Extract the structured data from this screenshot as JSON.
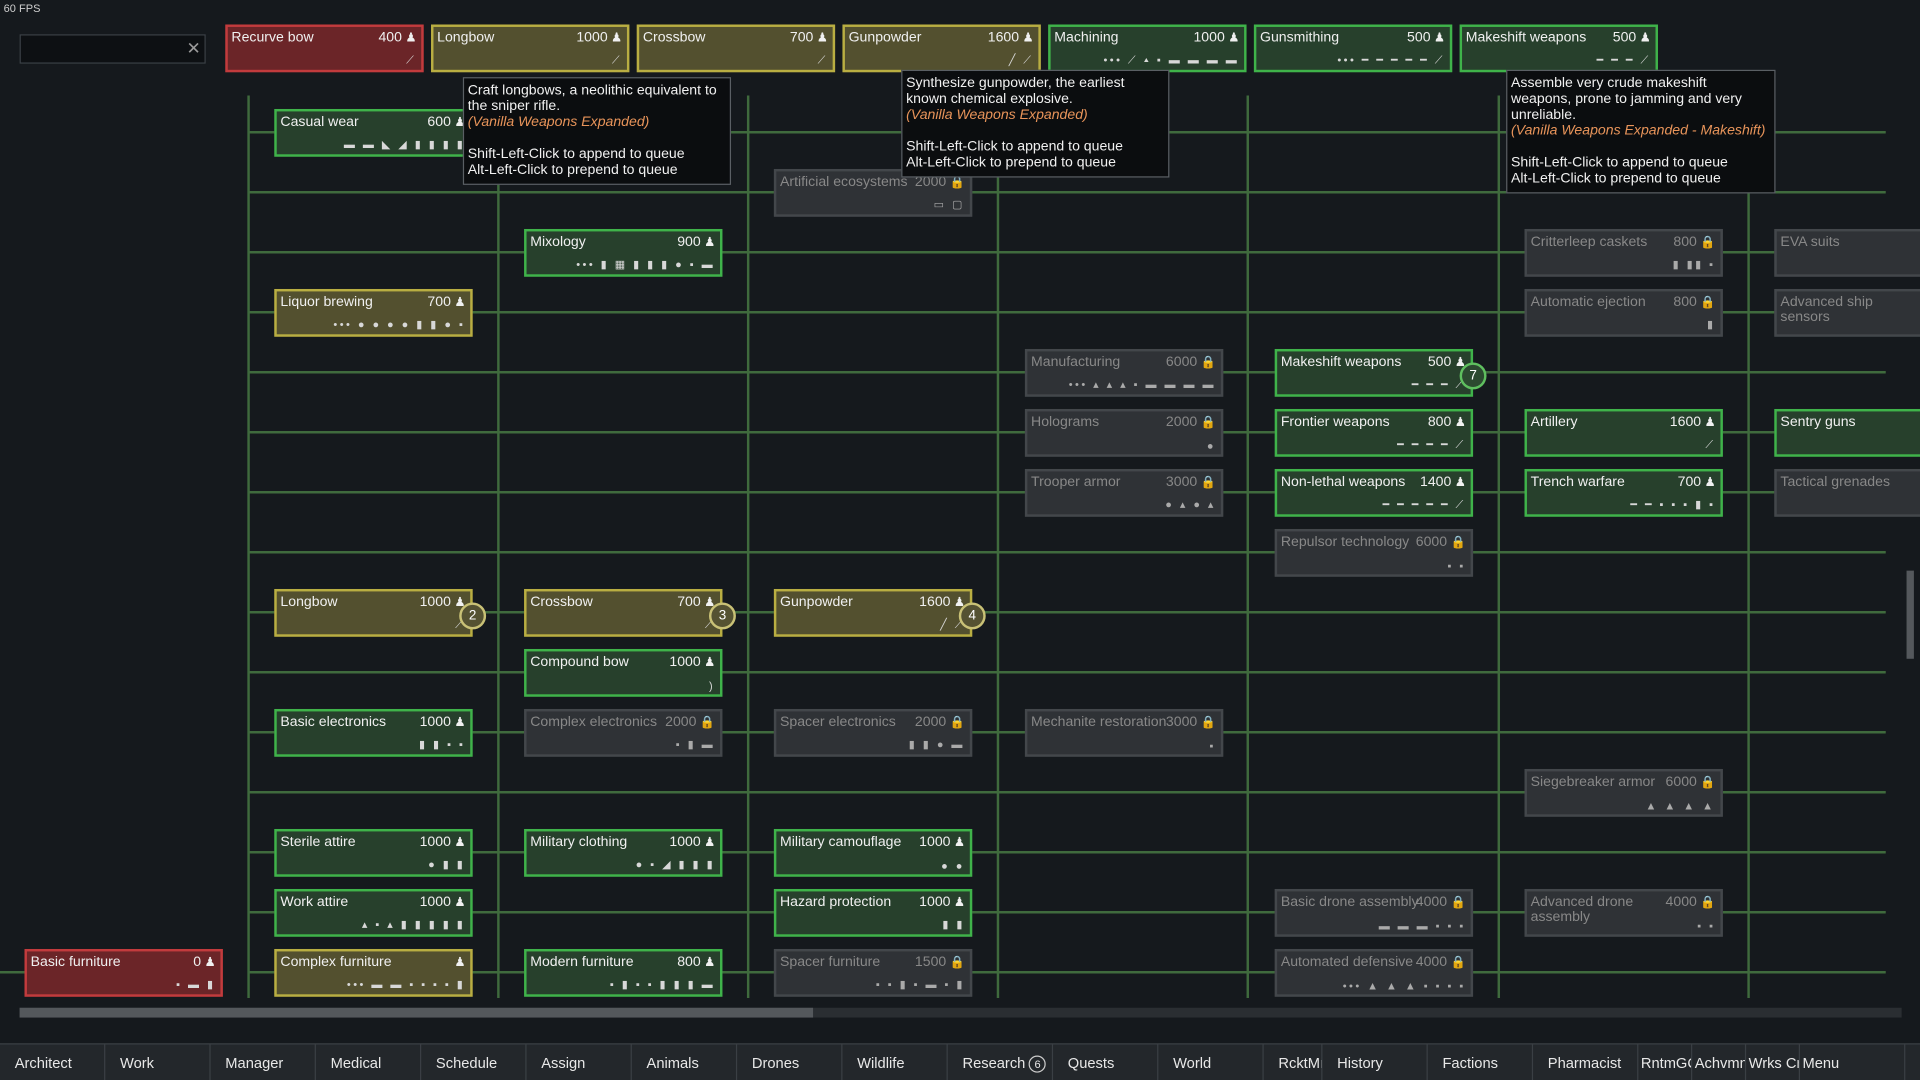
{
  "fps": "60 FPS",
  "search": {
    "value": "",
    "placeholder": ""
  },
  "colors": {
    "done": "#3fb34a",
    "queued": "#b9ae42",
    "selected": "#c23b3d",
    "locked": "#43474b",
    "wire": "#3f6a3d"
  },
  "queue": [
    {
      "name": "Recurve bow",
      "cost": "400",
      "state": "sel",
      "icons": "⟋"
    },
    {
      "name": "Longbow",
      "cost": "1000",
      "state": "queued",
      "icons": "⟋"
    },
    {
      "name": "Crossbow",
      "cost": "700",
      "state": "queued",
      "icons": "⟋"
    },
    {
      "name": "Gunpowder",
      "cost": "1600",
      "state": "queued",
      "icons": "╱ ⟋"
    },
    {
      "name": "Machining",
      "cost": "1000",
      "state": "done",
      "icons": "••• ⟋ ▴ ▪ ▬ ▬ ▬ ▬"
    },
    {
      "name": "Gunsmithing",
      "cost": "500",
      "state": "done",
      "icons": "••• ━ ━ ━ ━ ━ ⟋"
    },
    {
      "name": "Makeshift weapons",
      "cost": "500",
      "state": "done",
      "icons": "━ ━ ━ ⟋"
    }
  ],
  "nodes": [
    {
      "name": "Casual wear",
      "cost": "600",
      "state": "done",
      "icons": "▬ ▬ ◣ ◢ ▮ ▮ ▮ ▮"
    },
    {
      "name": "Artificial ecosystems",
      "cost": "2000",
      "state": "locked",
      "icons": "▭ ▢"
    },
    {
      "name": "Mixology",
      "cost": "900",
      "state": "done",
      "icons": "••• ▮ ▦ ▮ ▮ ▮ ● ▪ ▬"
    },
    {
      "name": "Liquor brewing",
      "cost": "700",
      "state": "queued",
      "icons": "••• ● ● ● ● ▮ ▮ ● ▪"
    },
    {
      "name": "Critterleep caskets",
      "cost": "800",
      "state": "locked",
      "icons": "▮ ▮▮ ▪"
    },
    {
      "name": "EVA suits",
      "cost": "",
      "state": "locked",
      "icons": ""
    },
    {
      "name": "Automatic ejection",
      "cost": "800",
      "state": "locked",
      "icons": "▮"
    },
    {
      "name": "Advanced ship sensors",
      "cost": "",
      "state": "locked",
      "icons": ""
    },
    {
      "name": "Manufacturing",
      "cost": "6000",
      "state": "locked",
      "icons": "••• ▴ ▴ ▴ ▪ ▬ ▬ ▬ ▬"
    },
    {
      "name": "Makeshift weapons",
      "cost": "500",
      "state": "done",
      "icons": "━ ━ ━ ⟋"
    },
    {
      "name": "Holograms",
      "cost": "2000",
      "state": "locked",
      "icons": "●"
    },
    {
      "name": "Frontier weapons",
      "cost": "800",
      "state": "done",
      "icons": "━ ━ ━ ━ ⟋"
    },
    {
      "name": "Artillery",
      "cost": "1600",
      "state": "done",
      "icons": "⟋"
    },
    {
      "name": "Sentry guns",
      "cost": "",
      "state": "done",
      "icons": ""
    },
    {
      "name": "Trooper armor",
      "cost": "3000",
      "state": "locked",
      "icons": "● ▴ ● ▴"
    },
    {
      "name": "Non-lethal weapons",
      "cost": "1400",
      "state": "done",
      "icons": "━ ━ ━ ━ ━ ⟋"
    },
    {
      "name": "Trench warfare",
      "cost": "700",
      "state": "done",
      "icons": "━ ━ ▪ ▪ ▪ ▮ ▪"
    },
    {
      "name": "Tactical grenades",
      "cost": "",
      "state": "locked",
      "icons": "▪ ▪ ▪"
    },
    {
      "name": "Repulsor technology",
      "cost": "6000",
      "state": "locked",
      "icons": "▪ ▪"
    },
    {
      "name": "Longbow",
      "cost": "1000",
      "state": "queued",
      "icons": "⟋"
    },
    {
      "name": "Crossbow",
      "cost": "700",
      "state": "queued",
      "icons": "⟋"
    },
    {
      "name": "Gunpowder",
      "cost": "1600",
      "state": "queued",
      "icons": "╱ ⟋"
    },
    {
      "name": "Compound bow",
      "cost": "1000",
      "state": "done",
      "icons": ")"
    },
    {
      "name": "Basic electronics",
      "cost": "1000",
      "state": "done",
      "icons": "▮ ▮ ▪ ▪"
    },
    {
      "name": "Complex electronics",
      "cost": "2000",
      "state": "locked",
      "icons": "▪ ▮ ▬"
    },
    {
      "name": "Spacer electronics",
      "cost": "2000",
      "state": "locked",
      "icons": "▮ ▮ ● ▬"
    },
    {
      "name": "Mechanite restoration",
      "cost": "3000",
      "state": "locked",
      "icons": "▪"
    },
    {
      "name": "Siegebreaker armor",
      "cost": "6000",
      "state": "locked",
      "icons": "▲ ▲ ▲ ▲"
    },
    {
      "name": "Sterile attire",
      "cost": "1000",
      "state": "done",
      "icons": "● ▮ ▮"
    },
    {
      "name": "Military clothing",
      "cost": "1000",
      "state": "done",
      "icons": "● ▪ ◢ ▮ ▮ ▮"
    },
    {
      "name": "Military camouflage",
      "cost": "1000",
      "state": "done",
      "icons": "● ●"
    },
    {
      "name": "Work attire",
      "cost": "1000",
      "state": "done",
      "icons": "▴ ▪ ▴ ▮ ▮ ▮ ▮ ▮"
    },
    {
      "name": "Hazard protection",
      "cost": "1000",
      "state": "done",
      "icons": "▮ ▮"
    },
    {
      "name": "Basic drone assembly",
      "cost": "4000",
      "state": "locked",
      "icons": "▬ ▬ ▬ ▪ ▪ ▪"
    },
    {
      "name": "Advanced drone assembly",
      "cost": "4000",
      "state": "locked",
      "icons": "▪ ▪"
    },
    {
      "name": "Basic furniture",
      "cost": "0",
      "state": "sel",
      "icons": "▪ ▬ ▮"
    },
    {
      "name": "Complex furniture",
      "cost": "",
      "state": "queued",
      "icons": "••• ▬ ▬ ▪ ▪ ▪ ▪ ▮"
    },
    {
      "name": "Modern furniture",
      "cost": "800",
      "state": "done",
      "icons": "▪ ▮ ▪ ▪ ▮ ▮ ▮ ▬"
    },
    {
      "name": "Spacer furniture",
      "cost": "1500",
      "state": "locked",
      "icons": "▪ ▪ ▮ ▪ ▬ ▪ ▮"
    },
    {
      "name": "Automated defensive",
      "cost": "4000",
      "state": "locked",
      "icons": "••• ▲ ▲ ▲ ▪ ▪ ▪ ▪"
    }
  ],
  "badges": [
    "2",
    "3",
    "4",
    "7"
  ],
  "tooltips": [
    {
      "lines": [
        "Craft longbows, a neolithic equivalent to",
        "the sniper rifle."
      ],
      "source": "(Vanilla Weapons Expanded)",
      "hint1": "Shift-Left-Click to append to queue",
      "hint2": "Alt-Left-Click to prepend to queue"
    },
    {
      "lines": [
        "Synthesize gunpowder, the earliest",
        "known chemical explosive."
      ],
      "source": "(Vanilla Weapons Expanded)",
      "hint1": "Shift-Left-Click to append to queue",
      "hint2": "Alt-Left-Click to prepend to queue"
    },
    {
      "lines": [
        "Assemble very crude makeshift",
        "weapons, prone to jamming and very",
        "unreliable."
      ],
      "source": "(Vanilla Weapons Expanded - Makeshift)",
      "hint1": "Shift-Left-Click to append to queue",
      "hint2": "Alt-Left-Click to prepend to queue"
    }
  ],
  "tabs": [
    {
      "label": "Architect"
    },
    {
      "label": "Work"
    },
    {
      "label": "Manager"
    },
    {
      "label": "Medical"
    },
    {
      "label": "Schedule"
    },
    {
      "label": "Assign"
    },
    {
      "label": "Animals"
    },
    {
      "label": "Drones"
    },
    {
      "label": "Wildlife"
    },
    {
      "label": "Research",
      "count": "6"
    },
    {
      "label": "Quests"
    },
    {
      "label": "World"
    },
    {
      "label": "RcktMn"
    },
    {
      "label": "History"
    },
    {
      "label": "Factions"
    },
    {
      "label": "Pharmacist"
    },
    {
      "label": "RntmGC"
    },
    {
      "label": "Achvmn"
    },
    {
      "label": "Wrks Cr"
    },
    {
      "label": "Menu"
    }
  ]
}
